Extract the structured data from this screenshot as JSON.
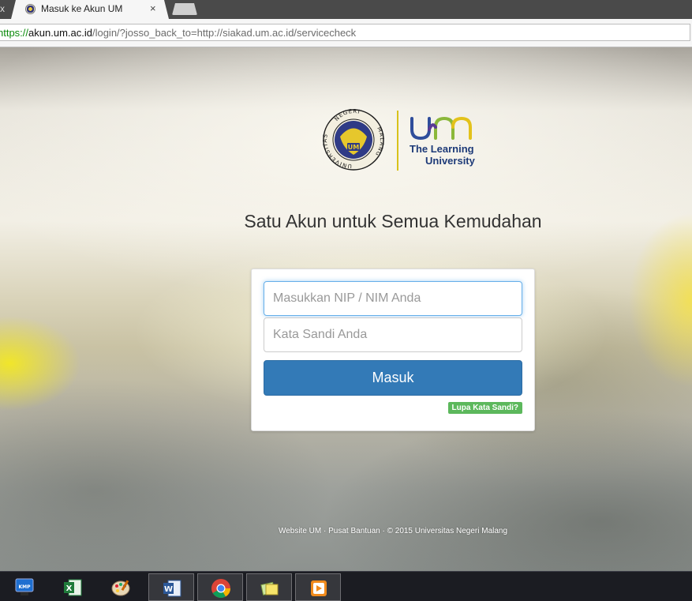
{
  "browser": {
    "prev_tab_close": "x",
    "tab_title": "Masuk ke Akun UM",
    "tab_close": "×",
    "url_proto": "https://",
    "url_host": "akun.um.ac.id",
    "url_rest": "/login/?josso_back_to=http://siakad.um.ac.id/servicecheck"
  },
  "branding": {
    "seal_text_top": "NEGERI",
    "seal_text_left": "UNIVERSITAS",
    "seal_text_right": "MALANG",
    "seal_center": "UM",
    "logo_word": "um",
    "tagline_1": "The Learning",
    "tagline_2": "University",
    "colors": {
      "navy": "#1d3a78",
      "yellow": "#e3c21b",
      "green": "#9cc23a",
      "purple": "#5b3a94"
    }
  },
  "page": {
    "headline": "Satu Akun untuk Semua Kemudahan"
  },
  "login": {
    "username_placeholder": "Masukkan NIP / NIM Anda",
    "password_placeholder": "Kata Sandi Anda",
    "submit_label": "Masuk",
    "forgot_label": "Lupa Kata Sandi?",
    "colors": {
      "primary": "#337ab7",
      "success": "#5cb85c"
    }
  },
  "footer": {
    "text": "Website UM · Pusat Bantuan · © 2015 Universitas Negeri Malang"
  },
  "taskbar": {
    "items": [
      {
        "name": "kmplayer-icon",
        "label": "KMP"
      },
      {
        "name": "excel-icon",
        "label": "X"
      },
      {
        "name": "paint-icon",
        "label": ""
      },
      {
        "name": "word-icon",
        "label": "W"
      },
      {
        "name": "chrome-icon",
        "label": ""
      },
      {
        "name": "notes-icon",
        "label": ""
      },
      {
        "name": "media-player-icon",
        "label": ""
      }
    ]
  }
}
